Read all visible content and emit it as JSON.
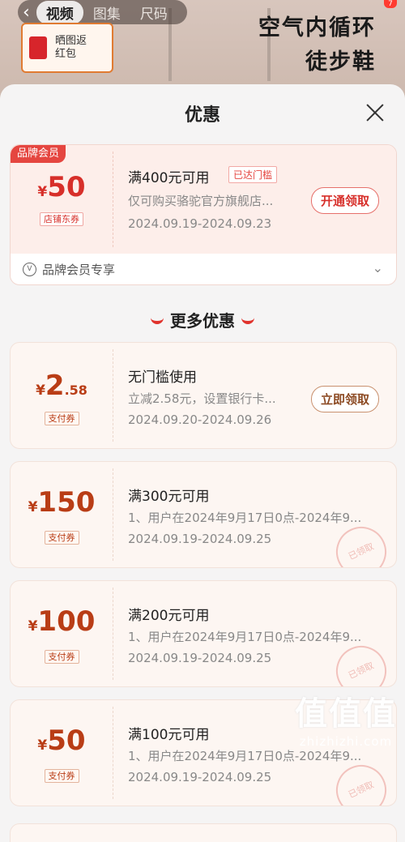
{
  "top": {
    "tabs": [
      "视频",
      "图集",
      "尺码"
    ],
    "promo": "晒图返红包",
    "promo_header": "晒图返",
    "slogan_line1": "空气内循环",
    "slogan_line2": "徒步鞋",
    "badge": "7"
  },
  "sheet": {
    "title": "优惠",
    "member": {
      "badge": "品牌会员",
      "currency": "¥",
      "amount": "50",
      "tag": "店铺东券",
      "condition": "满400元可用",
      "reached": "已达门槛",
      "description": "仅可购买骆驼官方旗舰店...",
      "date": "2024.09.19-2024.09.23",
      "button": "开通领取",
      "footer": "品牌会员专享"
    },
    "more_title": "更多优惠",
    "coupons": [
      {
        "currency": "¥",
        "amount": "2",
        "decimal": ".58",
        "tag": "支付券",
        "condition": "无门槛使用",
        "description": "立减2.58元，设置银行卡...",
        "date": "2024.09.20-2024.09.26",
        "button": "立即领取"
      },
      {
        "currency": "¥",
        "amount": "150",
        "tag": "支付券",
        "condition": "满300元可用",
        "description": "1、用户在2024年9月17日0点-2024年9...",
        "date": "2024.09.19-2024.09.25",
        "stamp": "已领取"
      },
      {
        "currency": "¥",
        "amount": "100",
        "tag": "支付券",
        "condition": "满200元可用",
        "description": "1、用户在2024年9月17日0点-2024年9...",
        "date": "2024.09.19-2024.09.25",
        "stamp": "已领取"
      },
      {
        "currency": "¥",
        "amount": "50",
        "tag": "支付券",
        "condition": "满100元可用",
        "description": "1、用户在2024年9月17日0点-2024年9...",
        "date": "2024.09.19-2024.09.25",
        "stamp": "已领取"
      }
    ]
  },
  "watermark": {
    "big": "值值值",
    "small": "zhizhizhi.com"
  },
  "colors": {
    "accent_red": "#d72f2a",
    "coupon_brown": "#b93d16",
    "sheet_bg": "#f5f4f4"
  }
}
